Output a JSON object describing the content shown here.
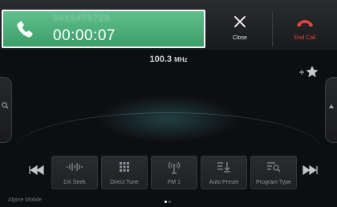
{
  "call": {
    "caller_number": "0415475728",
    "timer": "00:00:07"
  },
  "top_actions": {
    "close_label": "Close",
    "end_call_label": "End Call"
  },
  "radio": {
    "frequency": "100.3",
    "unit": "MHz"
  },
  "controls": [
    {
      "label": "DX Seek",
      "icon": "dx-seek-icon"
    },
    {
      "label": "Direct Tune",
      "icon": "keypad-icon"
    },
    {
      "label": "FM 1",
      "icon": "antenna-icon"
    },
    {
      "label": "Auto Preset",
      "icon": "auto-preset-icon"
    },
    {
      "label": "Program Type",
      "icon": "program-type-icon"
    }
  ],
  "footer": {
    "text": "Alpine Mobile"
  },
  "colors": {
    "call_banner": "#4fb07b",
    "end_call": "#e0463f",
    "active_dot": "#ffffff",
    "inactive_dot": "#555555"
  }
}
